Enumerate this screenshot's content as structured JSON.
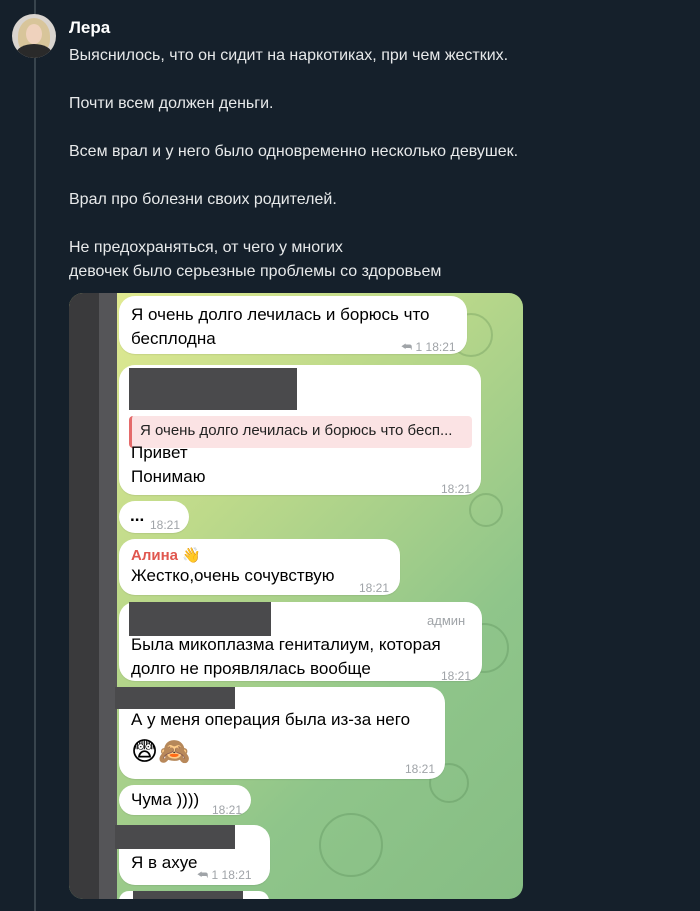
{
  "post": {
    "author": "Лера",
    "paragraphs": [
      "Выяснилось, что он сидит на наркотиках, при чем жестких.",
      "Почти всем должен деньги.",
      "Всем врал и у него было одновременно несколько девушек.",
      "Врал про болезни своих родителей.",
      "Не предохраняться, от чего у многих",
      "девочек было серьезные проблемы со здоровьем"
    ]
  },
  "chat": {
    "messages": [
      {
        "text_line1": "Я очень долго лечилась и борюсь что",
        "text_line2": "бесплодна",
        "reply_count": "1",
        "time": "18:21"
      },
      {
        "quote": "Я очень долго лечилась и борюсь что бесп...",
        "text_line1": "Привет",
        "text_line2": "Понимаю",
        "time": "18:21"
      },
      {
        "text": "...",
        "time": "18:21"
      },
      {
        "sender": "Алина",
        "sender_emoji": "👋",
        "text": "Жестко,очень сочувствую",
        "time": "18:21"
      },
      {
        "badge": "админ",
        "text_line1": "Была микоплазма гениталиум, которая",
        "text_line2": "долго не проявлялась вообще",
        "time": "18:21"
      },
      {
        "text": "А у меня операция была из-за него",
        "emojis": "😨🙈",
        "time": "18:21"
      },
      {
        "text": "Чума ))))",
        "time": "18:21"
      },
      {
        "text": "Я в ахуе",
        "reply_count": "1",
        "time": "18:21"
      }
    ]
  }
}
